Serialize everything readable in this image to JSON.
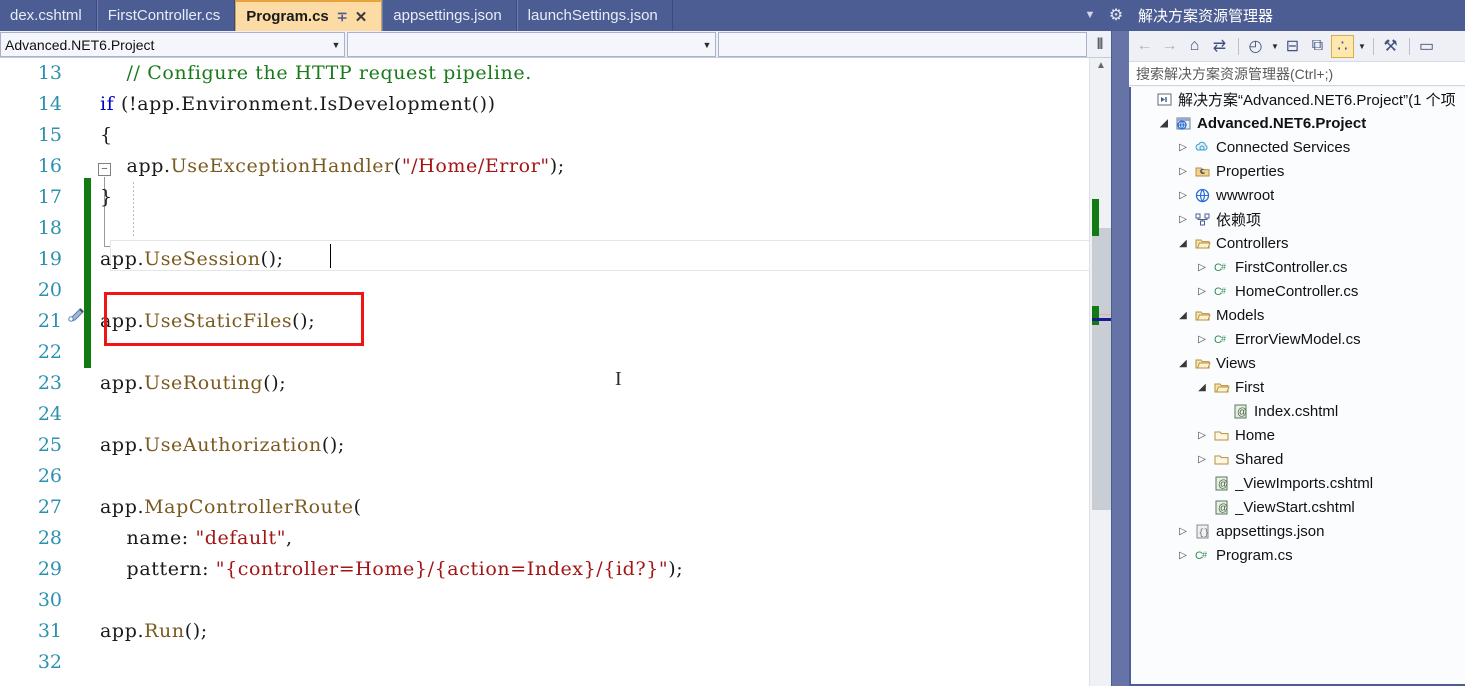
{
  "tabs": [
    {
      "label": "dex.cshtml",
      "active": false,
      "pin": "",
      "close": ""
    },
    {
      "label": "FirstController.cs",
      "active": false,
      "pin": "",
      "close": ""
    },
    {
      "label": "Program.cs",
      "active": true,
      "pin": "∓",
      "close": "✕"
    },
    {
      "label": "appsettings.json",
      "active": false,
      "pin": "",
      "close": ""
    },
    {
      "label": "launchSettings.json",
      "active": false,
      "pin": "",
      "close": ""
    }
  ],
  "tab_controls": {
    "dropdown": "▼",
    "settings": "⚙"
  },
  "nav_bar": {
    "project_combo": "Advanced.NET6.Project",
    "type_combo": "",
    "member_combo": "",
    "arrow": "▼",
    "split_view": "⫴"
  },
  "editor": {
    "lines": [
      {
        "num": "13",
        "tokens": [
          {
            "t": "    // Configure the HTTP request pipeline.",
            "c": "cmt"
          }
        ]
      },
      {
        "num": "14",
        "tokens": [
          {
            "t": "if",
            "c": "kw"
          },
          {
            "t": " (!app.Environment.IsDevelopment())",
            "c": "id"
          }
        ]
      },
      {
        "num": "15",
        "tokens": [
          {
            "t": "{",
            "c": "pun"
          }
        ]
      },
      {
        "num": "16",
        "tokens": [
          {
            "t": "    app.",
            "c": "id"
          },
          {
            "t": "UseExceptionHandler",
            "c": "mth"
          },
          {
            "t": "(",
            "c": "pun"
          },
          {
            "t": "\"/Home/Error\"",
            "c": "str"
          },
          {
            "t": ");",
            "c": "pun"
          }
        ]
      },
      {
        "num": "17",
        "tokens": [
          {
            "t": "}",
            "c": "pun"
          }
        ]
      },
      {
        "num": "18",
        "tokens": [
          {
            "t": "",
            "c": "id"
          }
        ]
      },
      {
        "num": "19",
        "tokens": [
          {
            "t": "app.",
            "c": "id"
          },
          {
            "t": "UseSession",
            "c": "mth"
          },
          {
            "t": "();",
            "c": "pun"
          }
        ]
      },
      {
        "num": "20",
        "tokens": [
          {
            "t": "",
            "c": "id"
          }
        ]
      },
      {
        "num": "21",
        "tokens": [
          {
            "t": "app.",
            "c": "id"
          },
          {
            "t": "UseStaticFiles",
            "c": "mth"
          },
          {
            "t": "();",
            "c": "pun"
          }
        ]
      },
      {
        "num": "22",
        "tokens": [
          {
            "t": "",
            "c": "id"
          }
        ]
      },
      {
        "num": "23",
        "tokens": [
          {
            "t": "app.",
            "c": "id"
          },
          {
            "t": "UseRouting",
            "c": "mth"
          },
          {
            "t": "();",
            "c": "pun"
          }
        ]
      },
      {
        "num": "24",
        "tokens": [
          {
            "t": "",
            "c": "id"
          }
        ]
      },
      {
        "num": "25",
        "tokens": [
          {
            "t": "app.",
            "c": "id"
          },
          {
            "t": "UseAuthorization",
            "c": "mth"
          },
          {
            "t": "();",
            "c": "pun"
          }
        ]
      },
      {
        "num": "26",
        "tokens": [
          {
            "t": "",
            "c": "id"
          }
        ]
      },
      {
        "num": "27",
        "tokens": [
          {
            "t": "app.",
            "c": "id"
          },
          {
            "t": "MapControllerRoute",
            "c": "mth"
          },
          {
            "t": "(",
            "c": "pun"
          }
        ]
      },
      {
        "num": "28",
        "tokens": [
          {
            "t": "    name: ",
            "c": "id"
          },
          {
            "t": "\"default\"",
            "c": "str"
          },
          {
            "t": ",",
            "c": "pun"
          }
        ]
      },
      {
        "num": "29",
        "tokens": [
          {
            "t": "    pattern: ",
            "c": "id"
          },
          {
            "t": "\"{controller=Home}/{action=Index}/{id?}\"",
            "c": "str"
          },
          {
            "t": ");",
            "c": "pun"
          }
        ]
      },
      {
        "num": "30",
        "tokens": [
          {
            "t": "",
            "c": "id"
          }
        ]
      },
      {
        "num": "31",
        "tokens": [
          {
            "t": "app.",
            "c": "id"
          },
          {
            "t": "Run",
            "c": "mth"
          },
          {
            "t": "();",
            "c": "pun"
          }
        ]
      },
      {
        "num": "32",
        "tokens": [
          {
            "t": "",
            "c": "id"
          }
        ]
      }
    ],
    "collapse_glyph": "−",
    "pencil_icon": "✎",
    "ibeam_cursor": "I",
    "scroll_up_arrow": "▲"
  },
  "solution_explorer": {
    "title": "解决方案资源管理器",
    "search_placeholder": "搜索解决方案资源管理器(Ctrl+;)",
    "toolbar": [
      {
        "name": "back-icon",
        "glyph": "←",
        "state": "disabled"
      },
      {
        "name": "forward-icon",
        "glyph": "→",
        "state": "disabled"
      },
      {
        "name": "home-icon",
        "glyph": "⌂",
        "state": "normal"
      },
      {
        "name": "sync-with-active-document-icon",
        "glyph": "⇄",
        "state": "normal"
      },
      {
        "name": "pending-changes-filter-icon",
        "glyph": "◴",
        "state": "normal"
      },
      {
        "name": "collapse-all-icon",
        "glyph": "⊟",
        "state": "normal"
      },
      {
        "name": "show-all-files-icon",
        "glyph": "⧉",
        "state": "normal"
      },
      {
        "name": "preview-selected-items-icon",
        "glyph": "∴",
        "state": "active"
      },
      {
        "name": "properties-icon",
        "glyph": "⚒",
        "state": "normal"
      },
      {
        "name": "view-designer-icon",
        "glyph": "▭",
        "state": "normal"
      }
    ],
    "tree": [
      {
        "indent": 0,
        "twisty": "",
        "icon": "solution",
        "label": "解决方案“Advanced.NET6.Project”(1 个项",
        "bold": false,
        "selected": false
      },
      {
        "indent": 1,
        "twisty": "◢",
        "icon": "project",
        "label": "Advanced.NET6.Project",
        "bold": true,
        "selected": false
      },
      {
        "indent": 2,
        "twisty": "▷",
        "icon": "connected-services",
        "label": "Connected Services",
        "bold": false,
        "selected": false
      },
      {
        "indent": 2,
        "twisty": "▷",
        "icon": "properties",
        "label": "Properties",
        "bold": false,
        "selected": false
      },
      {
        "indent": 2,
        "twisty": "▷",
        "icon": "globe",
        "label": "wwwroot",
        "bold": false,
        "selected": false
      },
      {
        "indent": 2,
        "twisty": "▷",
        "icon": "dependencies",
        "label": "依赖项",
        "bold": false,
        "selected": false
      },
      {
        "indent": 2,
        "twisty": "◢",
        "icon": "folder-open",
        "label": "Controllers",
        "bold": false,
        "selected": false
      },
      {
        "indent": 3,
        "twisty": "▷",
        "icon": "csharp",
        "label": "FirstController.cs",
        "bold": false,
        "selected": false
      },
      {
        "indent": 3,
        "twisty": "▷",
        "icon": "csharp",
        "label": "HomeController.cs",
        "bold": false,
        "selected": false
      },
      {
        "indent": 2,
        "twisty": "◢",
        "icon": "folder-open",
        "label": "Models",
        "bold": false,
        "selected": false
      },
      {
        "indent": 3,
        "twisty": "▷",
        "icon": "csharp",
        "label": "ErrorViewModel.cs",
        "bold": false,
        "selected": false
      },
      {
        "indent": 2,
        "twisty": "◢",
        "icon": "folder-open",
        "label": "Views",
        "bold": false,
        "selected": false
      },
      {
        "indent": 3,
        "twisty": "◢",
        "icon": "folder-open",
        "label": "First",
        "bold": false,
        "selected": false
      },
      {
        "indent": 4,
        "twisty": "",
        "icon": "razor",
        "label": "Index.cshtml",
        "bold": false,
        "selected": false
      },
      {
        "indent": 3,
        "twisty": "▷",
        "icon": "folder",
        "label": "Home",
        "bold": false,
        "selected": false
      },
      {
        "indent": 3,
        "twisty": "▷",
        "icon": "folder",
        "label": "Shared",
        "bold": false,
        "selected": false
      },
      {
        "indent": 3,
        "twisty": "",
        "icon": "razor",
        "label": "_ViewImports.cshtml",
        "bold": false,
        "selected": false
      },
      {
        "indent": 3,
        "twisty": "",
        "icon": "razor",
        "label": "_ViewStart.cshtml",
        "bold": false,
        "selected": false
      },
      {
        "indent": 2,
        "twisty": "▷",
        "icon": "json",
        "label": "appsettings.json",
        "bold": false,
        "selected": false
      },
      {
        "indent": 2,
        "twisty": "▷",
        "icon": "csharp",
        "label": "Program.cs",
        "bold": false,
        "selected": true
      }
    ]
  },
  "annotations": {
    "code_highlight_target": "app.UseSession();",
    "tree_highlight_target": "Program.cs",
    "highlight_color": "#f01414"
  }
}
